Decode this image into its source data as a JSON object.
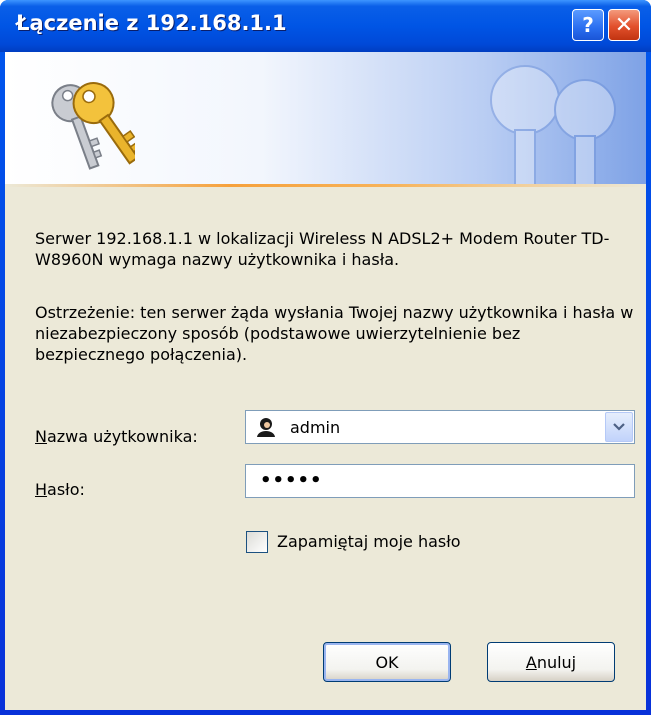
{
  "window": {
    "title": "Łączenie z 192.168.1.1",
    "help_label": "?",
    "close_label": "✕"
  },
  "message": {
    "line1": "Serwer 192.168.1.1 w lokalizacji Wireless N ADSL2+ Modem Router TD-W8960N wymaga nazwy użytkownika i hasła.",
    "line2": "Ostrzeżenie: ten serwer żąda wysłania Twojej nazwy użytkownika i hasła w niezabezpieczony sposób (podstawowe uwierzytelnienie bez bezpiecznego połączenia)."
  },
  "form": {
    "username_label_first": "N",
    "username_label_rest": "azwa użytkownika:",
    "username_value": "admin",
    "password_label_first": "H",
    "password_label_rest": "asło:",
    "password_dots": "•••••",
    "remember_label_pre": "Zapami",
    "remember_label_ul": "ę",
    "remember_label_post": "taj moje hasło",
    "remember_checked": false
  },
  "buttons": {
    "ok": "OK",
    "cancel_first": "A",
    "cancel_rest": "nuluj"
  },
  "icons": {
    "banner": "keys-icon",
    "user": "user-icon",
    "dropdown": "chevron-down-icon"
  }
}
